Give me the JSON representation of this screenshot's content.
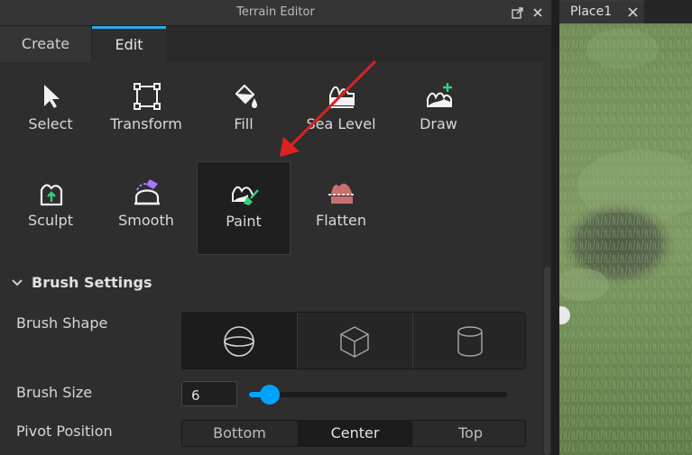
{
  "window": {
    "title": "Terrain Editor"
  },
  "tabs": [
    {
      "label": "Create",
      "active": false
    },
    {
      "label": "Edit",
      "active": true
    }
  ],
  "tools": [
    {
      "label": "Select",
      "icon": "select-arrow-icon"
    },
    {
      "label": "Transform",
      "icon": "transform-icon"
    },
    {
      "label": "Fill",
      "icon": "fill-bucket-icon"
    },
    {
      "label": "Sea Level",
      "icon": "sea-level-icon"
    },
    {
      "label": "Draw",
      "icon": "draw-terrain-icon"
    },
    {
      "label": "Sculpt",
      "icon": "sculpt-icon"
    },
    {
      "label": "Smooth",
      "icon": "smooth-icon"
    },
    {
      "label": "Paint",
      "icon": "paint-icon",
      "selected": true
    },
    {
      "label": "Flatten",
      "icon": "flatten-icon"
    }
  ],
  "brush_settings": {
    "title": "Brush Settings",
    "shape_label": "Brush Shape",
    "shapes": [
      "sphere-icon",
      "cube-icon",
      "cylinder-icon"
    ],
    "selected_shape": "sphere",
    "size_label": "Brush Size",
    "size_value": "6",
    "size_fraction": 0.08,
    "pivot_label": "Pivot Position",
    "pivot_options": [
      "Bottom",
      "Center",
      "Top"
    ],
    "pivot_selected": "Center"
  },
  "document": {
    "tab_label": "Place1"
  },
  "colors": {
    "accent": "#00a2ff",
    "tab_highlight": "#2aa8e8",
    "annotation_arrow": "#e02020",
    "terrain_green": "#6e8f55"
  }
}
